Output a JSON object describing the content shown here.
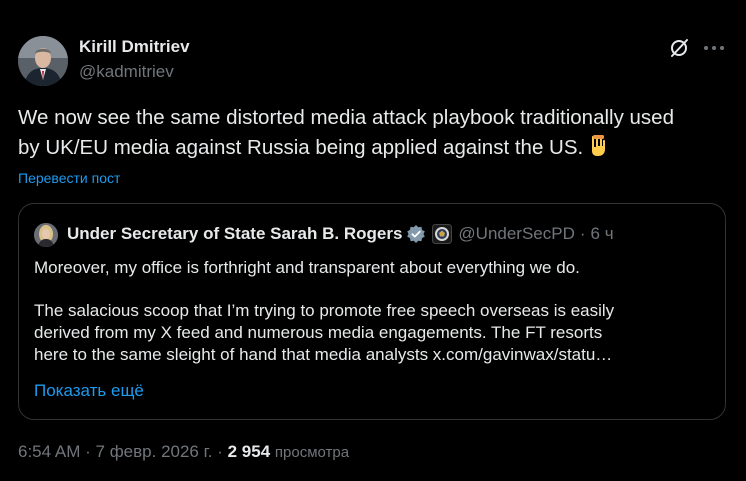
{
  "author": {
    "name": "Kirill Dmitriev",
    "handle": "@kadmitriev"
  },
  "tweet": {
    "text_line1": "We now see the same distorted media attack playbook traditionally used",
    "text_line2": "by UK/EU media against Russia being applied against the US.",
    "emoji": "backhand-index-pointing-down",
    "translate_label": "Перевести пост"
  },
  "quote": {
    "name": "Under Secretary of State Sarah B. Rogers",
    "handle": "@UnderSecPD",
    "separator": "·",
    "time": "6 ч",
    "paragraph1": "Moreover, my office is forthright and transparent about everything we do.",
    "p2_line1": "The salacious scoop that I’m trying to promote free speech overseas is easily",
    "p2_line2": "derived from my X feed and numerous media engagements.  The FT resorts",
    "p2_line3_text": "here to the same sleight of hand that media analysts ",
    "p2_line3_link": "x.com/gavinwax/statu…",
    "show_more": "Показать ещё"
  },
  "meta": {
    "time": "6:54 AM",
    "sep1": "·",
    "date": "7 февр. 2026 г.",
    "sep2": "·",
    "views_count": "2 954",
    "views_label": "просмотра"
  },
  "colors": {
    "background": "#000000",
    "text": "#e7e9ea",
    "secondary": "#71767b",
    "accent": "#1d9bf0",
    "border": "#2f3336"
  }
}
